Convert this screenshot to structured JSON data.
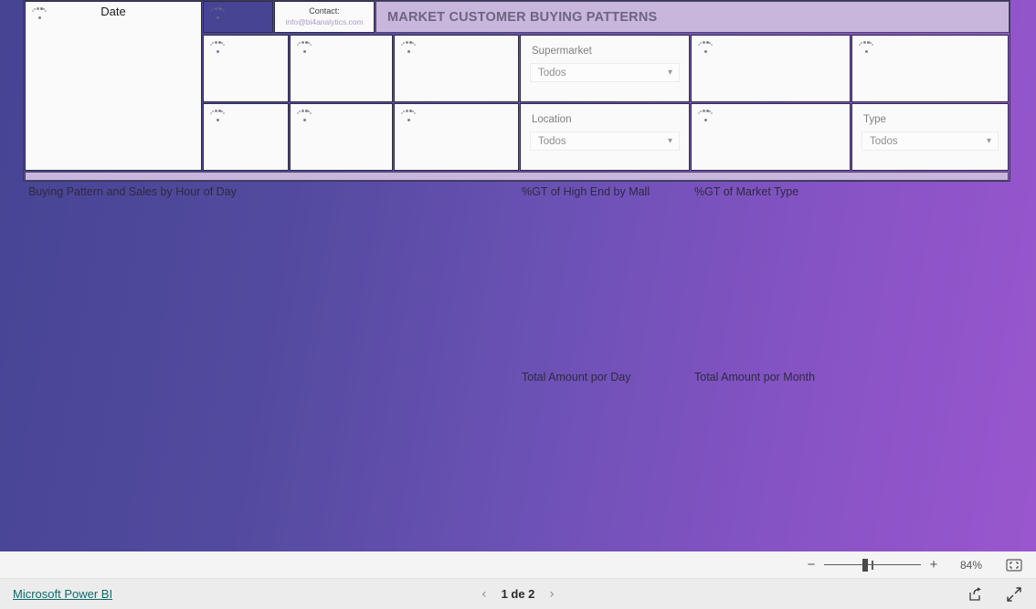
{
  "report": {
    "title": "MARKET CUSTOMER BUYING PATTERNS",
    "theme": {
      "gradient_start": "#474494",
      "gradient_end": "#9a56ce",
      "banner_bg": "#c8b6dc",
      "banner_text": "#6f6382",
      "card_bg": "#fafafa",
      "card_border": "#2f2c45",
      "link": "#0f6b6b"
    }
  },
  "date_slicer": {
    "title": "Date",
    "state_icon": "loading-spinner-icon"
  },
  "logo_tile": {
    "state_icon": "loading-spinner-icon"
  },
  "contact": {
    "label": "Contact:",
    "email": "info@bi4analytics.com"
  },
  "slicers": [
    {
      "label": "Supermarket",
      "value": "Todos",
      "caret": "▾"
    },
    {
      "label": "Location",
      "value": "Todos",
      "caret": "▾"
    },
    {
      "label": "Type",
      "value": "Todos",
      "caret": "▾"
    }
  ],
  "loading_cards": [
    {
      "name": "kpi-card-1",
      "state_icon": "loading-spinner-icon"
    },
    {
      "name": "kpi-card-2",
      "state_icon": "loading-spinner-icon"
    },
    {
      "name": "kpi-card-3",
      "state_icon": "loading-spinner-icon"
    },
    {
      "name": "kpi-card-4",
      "state_icon": "loading-spinner-icon"
    },
    {
      "name": "kpi-card-5",
      "state_icon": "loading-spinner-icon"
    },
    {
      "name": "kpi-card-6",
      "state_icon": "loading-spinner-icon"
    },
    {
      "name": "kpi-card-7",
      "state_icon": "loading-spinner-icon"
    },
    {
      "name": "kpi-card-8",
      "state_icon": "loading-spinner-icon"
    }
  ],
  "chart_titles": {
    "buying_pattern": "Buying Pattern and Sales  by Hour of Day",
    "high_end_by_mall": "%GT  of High End by Mall",
    "market_type": "%GT of Market Type",
    "amount_per_day": "Total Amount por Day",
    "amount_per_month": "Total Amount por Month"
  },
  "viewer": {
    "zoom_minus": "−",
    "zoom_plus": "+",
    "zoom_percent": "84%",
    "fit_icon": "fit-to-page-icon",
    "footer_link": "Microsoft Power BI",
    "prev_icon": "‹",
    "next_icon": "›",
    "page_label": "1 de 2",
    "share_icon": "share-icon",
    "fullscreen_icon": "fullscreen-icon"
  }
}
